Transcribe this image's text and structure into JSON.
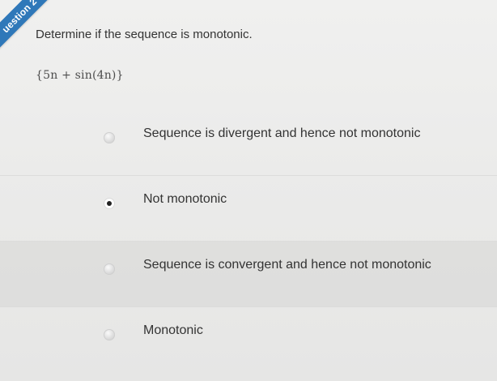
{
  "question": {
    "badge": "uestion 2",
    "prompt": "Determine if the sequence is monotonic.",
    "sequence": "{5n + sin(4n)}"
  },
  "options": [
    {
      "label": "Sequence is divergent and hence not monotonic",
      "selected": false
    },
    {
      "label": "Not monotonic",
      "selected": true
    },
    {
      "label": "Sequence is convergent and hence not monotonic",
      "selected": false
    },
    {
      "label": "Monotonic",
      "selected": false
    }
  ],
  "colors": {
    "badge": "#2f78b9",
    "background": "#ebebea"
  }
}
